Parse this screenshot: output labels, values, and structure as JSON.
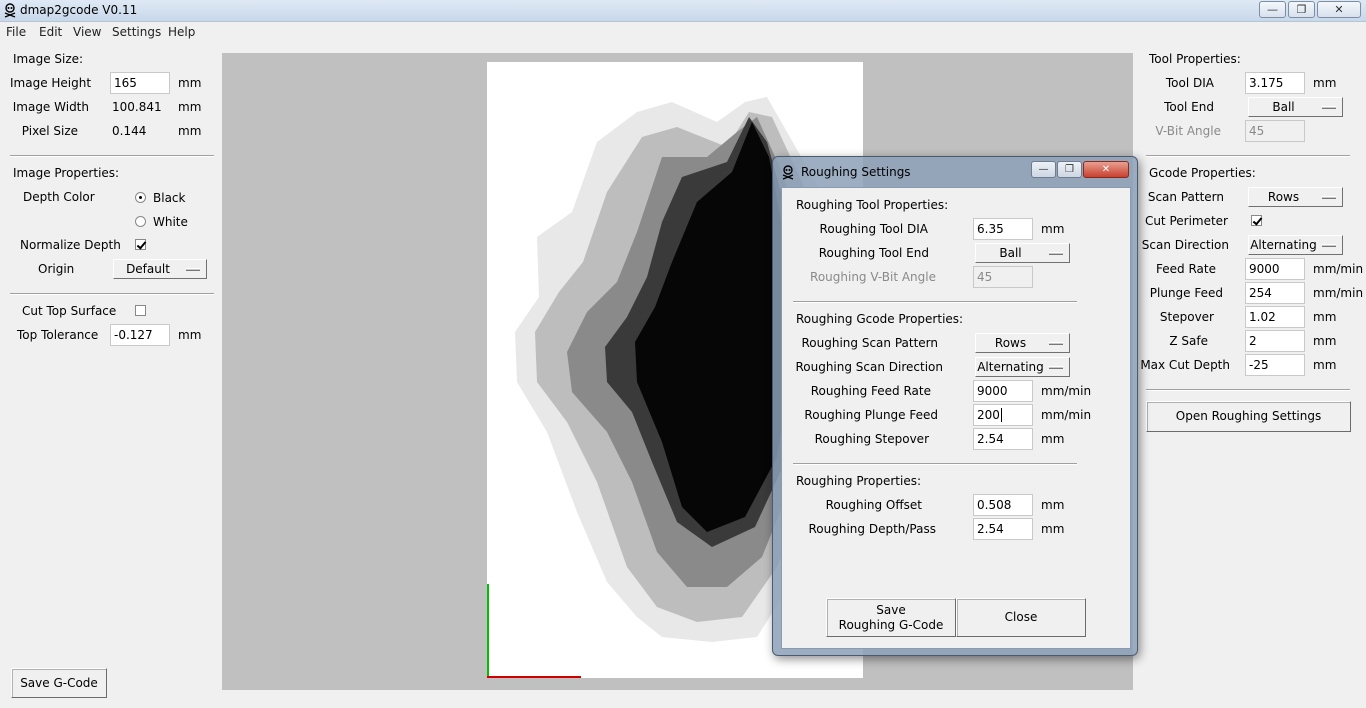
{
  "window": {
    "title": "dmap2gcode V0.11",
    "min_glyph": "—",
    "max_glyph": "❐",
    "close_glyph": "✕"
  },
  "menu": {
    "items": [
      "File",
      "Edit",
      "View",
      "Settings",
      "Help"
    ]
  },
  "left": {
    "image_size": {
      "heading": "Image Size:",
      "height_label": "Image Height",
      "height_value": "165",
      "height_unit": "mm",
      "width_label": "Image Width",
      "width_value": "100.841",
      "width_unit": "mm",
      "pixel_label": "Pixel Size",
      "pixel_value": "0.144",
      "pixel_unit": "mm"
    },
    "image_props": {
      "heading": "Image Properties:",
      "depth_color_label": "Depth Color",
      "option_black": "Black",
      "option_white": "White",
      "normalize_label": "Normalize Depth",
      "origin_label": "Origin",
      "origin_value": "Default"
    },
    "cut_top": {
      "label": "Cut Top Surface",
      "tolerance_label": "Top Tolerance",
      "tolerance_value": "-0.127",
      "tolerance_unit": "mm"
    },
    "save_button": "Save G-Code"
  },
  "right": {
    "tool": {
      "heading": "Tool Properties:",
      "dia_label": "Tool DIA",
      "dia_value": "3.175",
      "dia_unit": "mm",
      "end_label": "Tool End",
      "end_value": "Ball",
      "vbit_label": "V-Bit Angle",
      "vbit_value": "45"
    },
    "gcode": {
      "heading": "Gcode Properties:",
      "scan_pattern_label": "Scan Pattern",
      "scan_pattern_value": "Rows",
      "cut_perimeter_label": "Cut Perimeter",
      "scan_direction_label": "Scan Direction",
      "scan_direction_value": "Alternating",
      "feed_label": "Feed Rate",
      "feed_value": "9000",
      "feed_unit": "mm/min",
      "plunge_label": "Plunge Feed",
      "plunge_value": "254",
      "plunge_unit": "mm/min",
      "stepover_label": "Stepover",
      "stepover_value": "1.02",
      "stepover_unit": "mm",
      "zsafe_label": "Z Safe",
      "zsafe_value": "2",
      "zsafe_unit": "mm",
      "maxcut_label": "Max Cut Depth",
      "maxcut_value": "-25",
      "maxcut_unit": "mm"
    },
    "open_roughing_button": "Open Roughing Settings"
  },
  "dialog": {
    "title": "Roughing Settings",
    "tool_heading": "Roughing Tool Properties:",
    "dia_label": "Roughing Tool DIA",
    "dia_value": "6.35",
    "dia_unit": "mm",
    "end_label": "Roughing Tool End",
    "end_value": "Ball",
    "vbit_label": "Roughing V-Bit Angle",
    "vbit_value": "45",
    "gcode_heading": "Roughing Gcode Properties:",
    "scan_pattern_label": "Roughing Scan Pattern",
    "scan_pattern_value": "Rows",
    "scan_direction_label": "Roughing Scan Direction",
    "scan_direction_value": "Alternating",
    "feed_label": "Roughing Feed Rate",
    "feed_value": "9000",
    "feed_unit": "mm/min",
    "plunge_label": "Roughing Plunge Feed",
    "plunge_value": "200",
    "plunge_unit": "mm/min",
    "stepover_label": "Roughing Stepover",
    "stepover_value": "2.54",
    "stepover_unit": "mm",
    "props_heading": "Roughing Properties:",
    "offset_label": "Roughing Offset",
    "offset_value": "0.508",
    "offset_unit": "mm",
    "depth_label": "Roughing Depth/Pass",
    "depth_value": "2.54",
    "depth_unit": "mm",
    "save_line1": "Save",
    "save_line2": "Roughing G-Code",
    "close_button": "Close"
  },
  "colors": {
    "canvas_bg": "#c0c0c0",
    "axis_x": "#d00000",
    "axis_y": "#00c000"
  }
}
